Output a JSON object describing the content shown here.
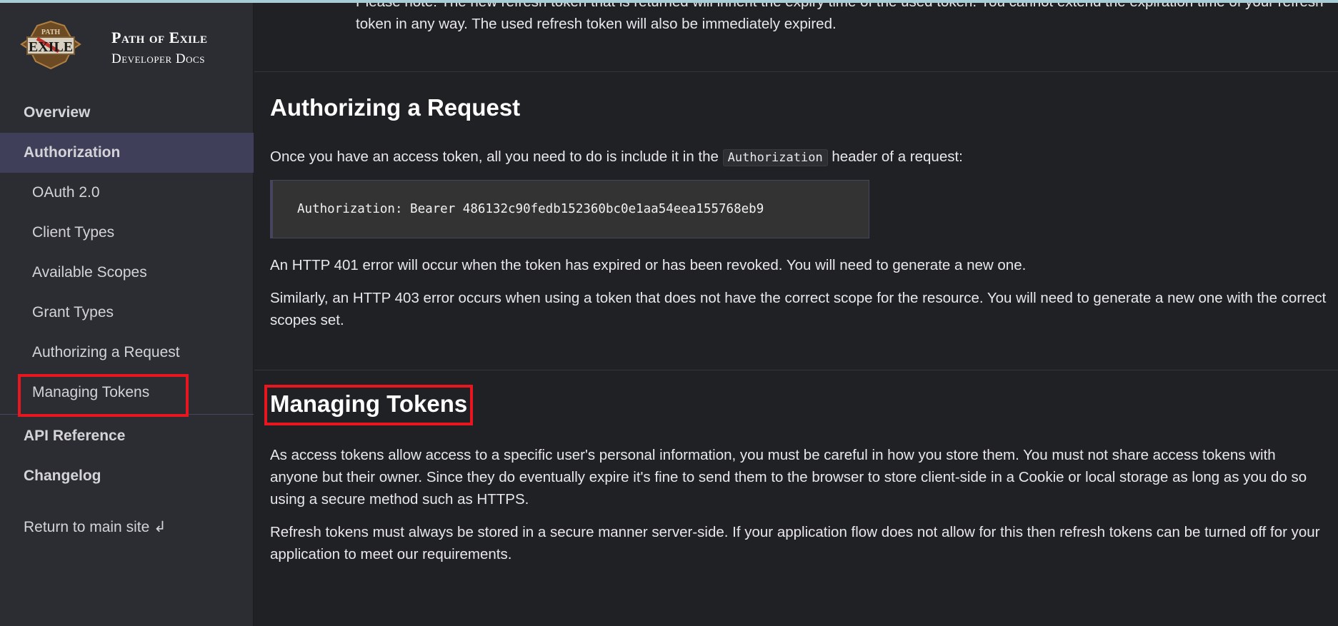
{
  "sidebar": {
    "brand": {
      "title": "Path of Exile",
      "subtitle": "Developer Docs",
      "logo_text": "PATH OF EXILE"
    },
    "items": [
      {
        "label": "Overview"
      },
      {
        "label": "Authorization",
        "active": true
      },
      {
        "label": "OAuth 2.0"
      },
      {
        "label": "Client Types"
      },
      {
        "label": "Available Scopes"
      },
      {
        "label": "Grant Types"
      },
      {
        "label": "Authorizing a Request"
      },
      {
        "label": "Managing Tokens",
        "highlighted": true
      },
      {
        "label": "API Reference"
      },
      {
        "label": "Changelog"
      }
    ],
    "return_link": "Return to main site ↲"
  },
  "main": {
    "lead_paragraph": "Please note: The new refresh token that is returned will inherit the expiry time of the used token. You cannot extend the expiration time of your refresh token in any way. The used refresh token will also be immediately expired.",
    "section1": {
      "title": "Authorizing a Request",
      "p1_before": "Once you have an access token, all you need to do is include it in the ",
      "p1_code": "Authorization",
      "p1_after": " header of a request:",
      "code_block": "Authorization: Bearer 486132c90fedb152360bc0e1aa54eea155768eb9",
      "p2": "An HTTP 401 error will occur when the token has expired or has been revoked. You will need to generate a new one.",
      "p3": "Similarly, an HTTP 403 error occurs when using a token that does not have the correct scope for the resource. You will need to generate a new one with the correct scopes set."
    },
    "section2": {
      "title": "Managing Tokens",
      "p1": "As access tokens allow access to a specific user's personal information, you must be careful in how you store them. You must not share access tokens with anyone but their owner. Since they do eventually expire it's fine to send them to the browser to store client-side in a Cookie or local storage as long as you do so using a secure method such as HTTPS.",
      "p2": "Refresh tokens must always be stored in a secure manner server-side. If your application flow does not allow for this then refresh tokens can be turned off for your application to meet our requirements."
    }
  },
  "colors": {
    "highlight": "#e8161f",
    "active_nav": "#3f3f5a",
    "sidebar_bg": "#2b2d33",
    "main_bg": "#202125"
  }
}
